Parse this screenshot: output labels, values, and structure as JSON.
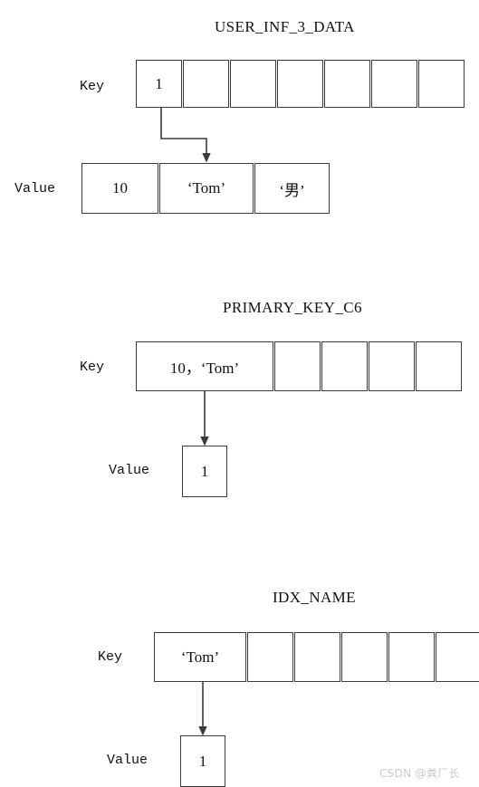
{
  "page": {
    "background_color": "#ffffff",
    "line_color": "#3b3b3b",
    "text_color": "#111111",
    "watermark": "CSDN @粪厂长"
  },
  "sections": [
    {
      "title": "USER_INF_3_DATA",
      "key_label": "Key",
      "value_label": "Value",
      "key_cells": [
        "1",
        "",
        "",
        "",
        "",
        "",
        ""
      ],
      "value_cells": [
        "10",
        "‘Tom’",
        "‘男’"
      ],
      "connector": "elbow-down-right-arrow"
    },
    {
      "title": "PRIMARY_KEY_C6",
      "key_label": "Key",
      "value_label": "Value",
      "key_cells": [
        "10，‘Tom’",
        "",
        "",
        "",
        ""
      ],
      "value_cells": [
        "1"
      ],
      "connector": "straight-down-arrow"
    },
    {
      "title": "IDX_NAME",
      "key_label": "Key",
      "value_label": "Value",
      "key_cells": [
        "‘Tom’",
        "",
        "",
        "",
        "",
        ""
      ],
      "value_cells": [
        "1"
      ],
      "connector": "straight-down-arrow"
    }
  ]
}
